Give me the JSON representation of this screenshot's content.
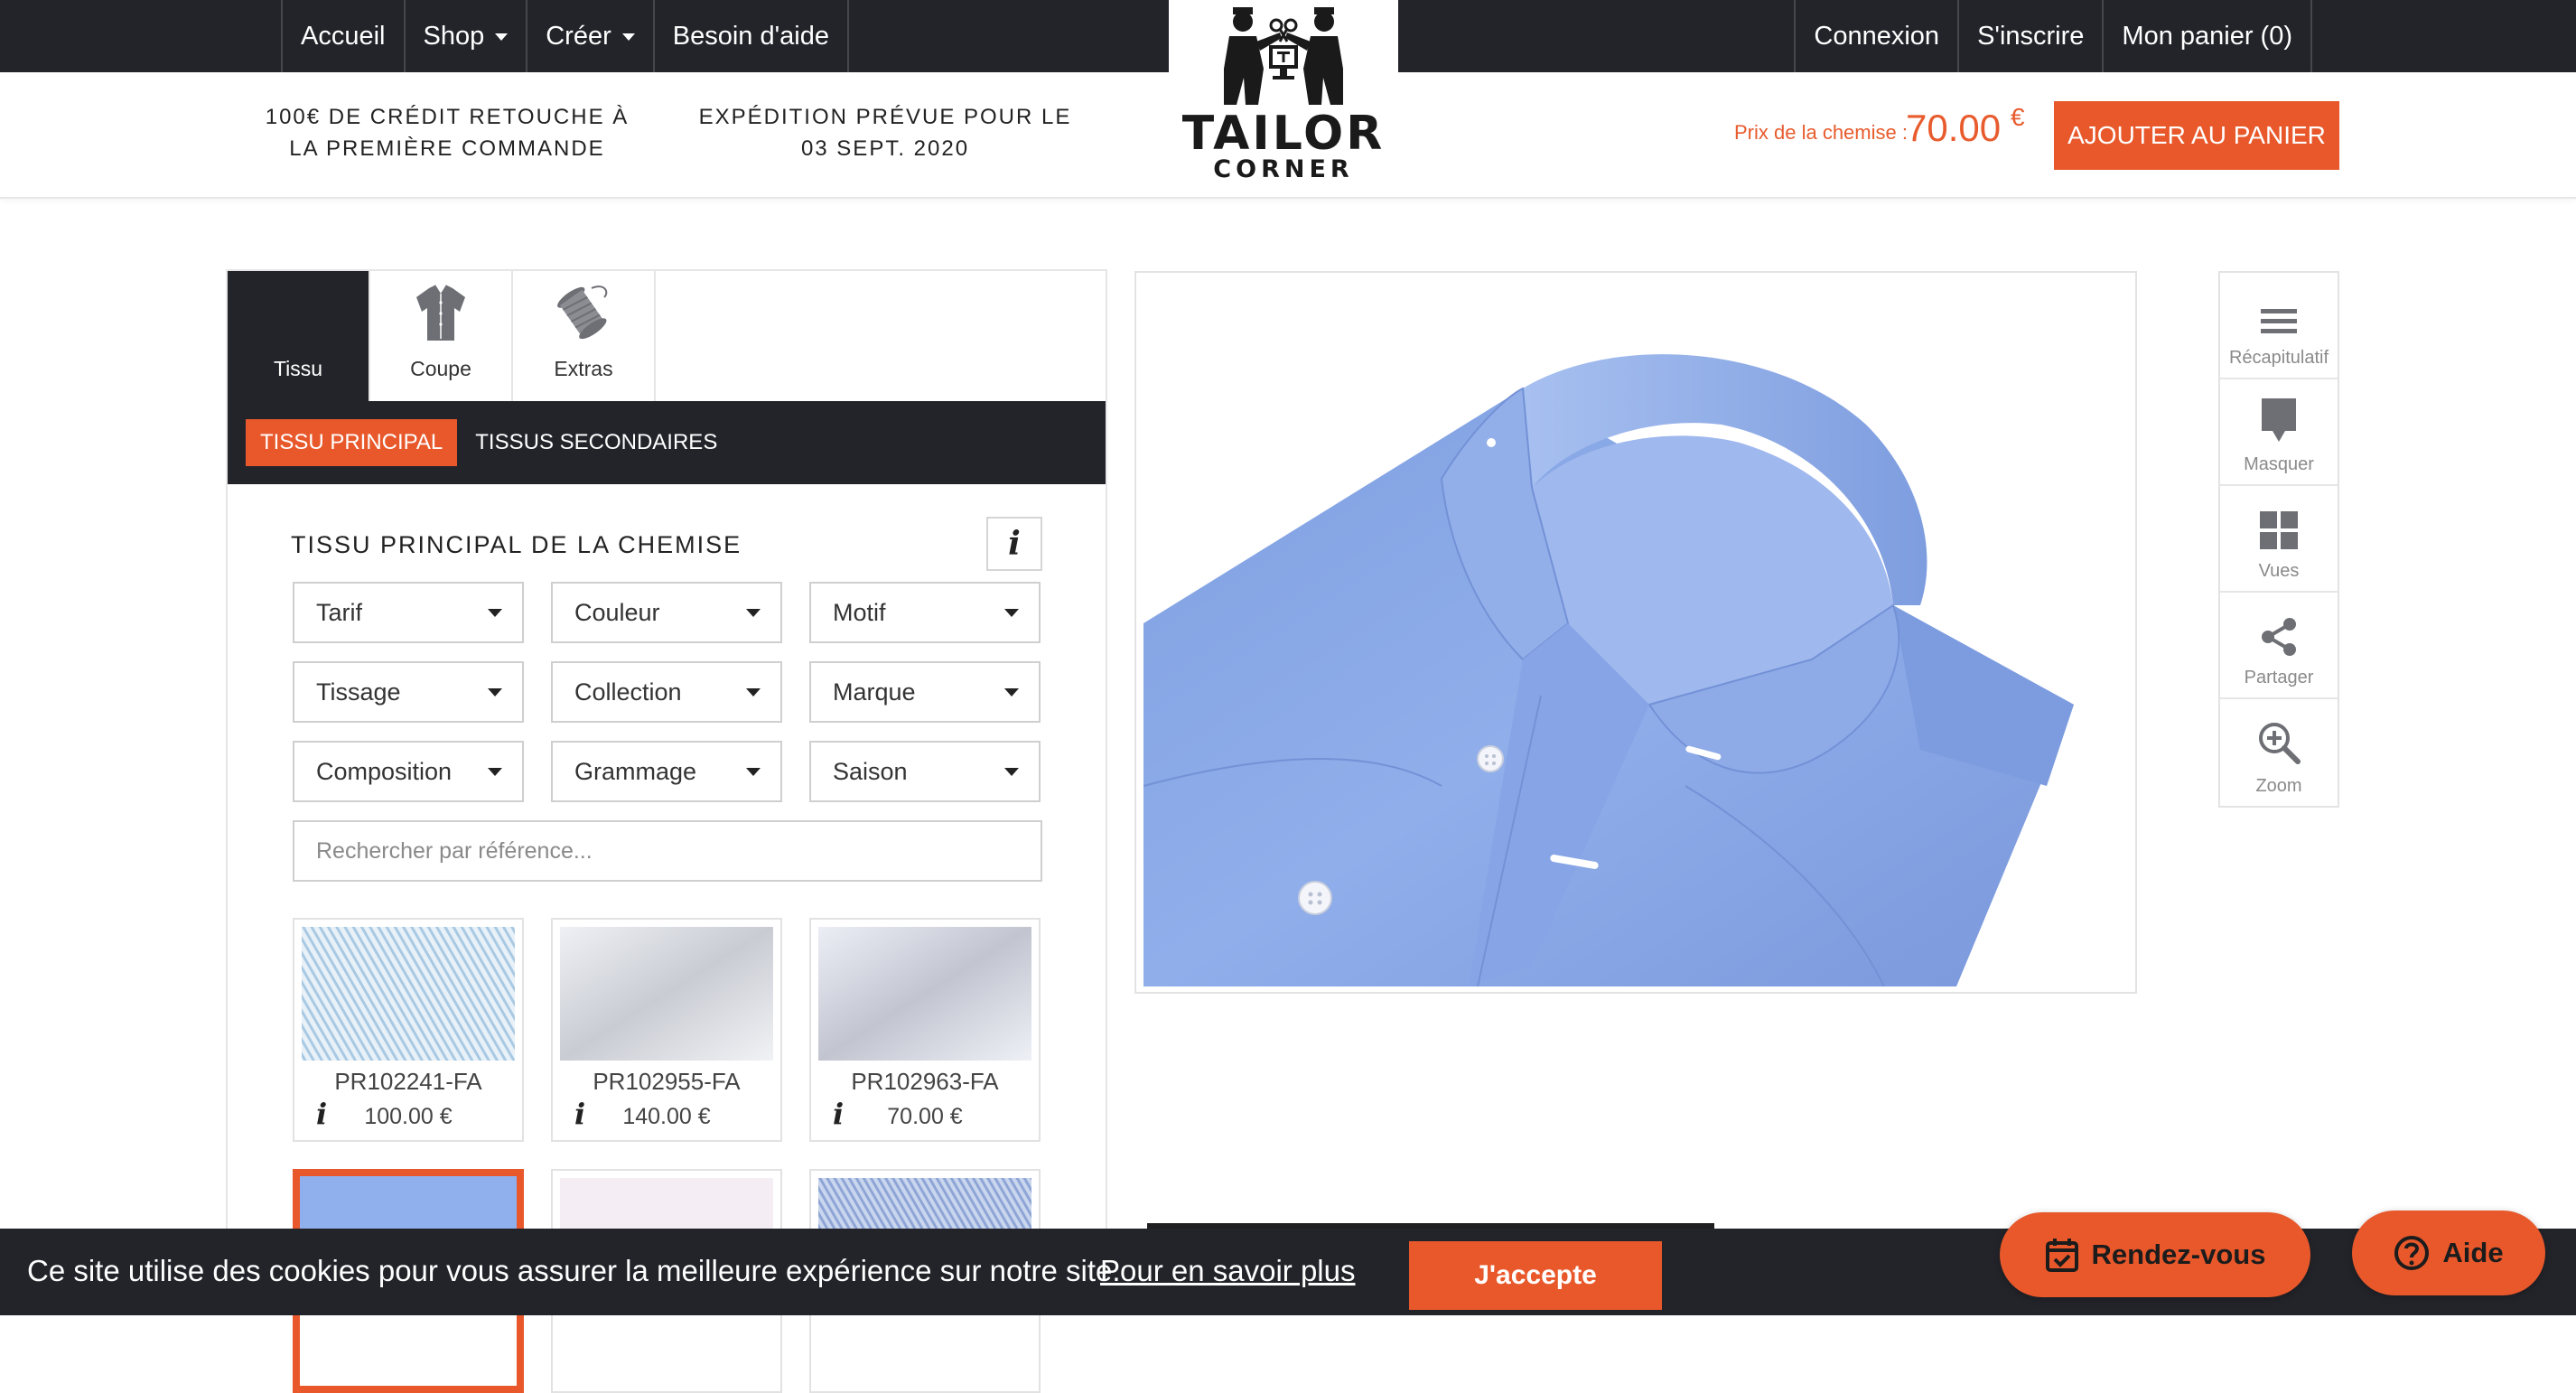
{
  "nav": {
    "left": [
      {
        "label": "Accueil",
        "dropdown": false
      },
      {
        "label": "Shop",
        "dropdown": true
      },
      {
        "label": "Créer",
        "dropdown": true
      },
      {
        "label": "Besoin d'aide",
        "dropdown": false
      }
    ],
    "right": [
      {
        "label": "Connexion"
      },
      {
        "label": "S'inscrire"
      },
      {
        "label": "Mon panier (0)"
      }
    ]
  },
  "logo": {
    "line1": "TAILOR",
    "line2": "CORNER"
  },
  "promo": {
    "credit": "100€ de crédit retouche à la première commande",
    "shipping": "Expédition prévue pour le 03 sept. 2020"
  },
  "price": {
    "label": "Prix de la chemise :",
    "value": "70.00",
    "currency": "€"
  },
  "add_to_cart": "Ajouter au panier",
  "tabs": [
    {
      "label": "Tissu",
      "icon": "fabric-icon",
      "active": true
    },
    {
      "label": "Coupe",
      "icon": "shirt-icon",
      "active": false
    },
    {
      "label": "Extras",
      "icon": "thread-spool-icon",
      "active": false
    }
  ],
  "subtabs": [
    {
      "label": "Tissu principal",
      "active": true
    },
    {
      "label": "Tissus secondaires",
      "active": false
    }
  ],
  "section_title": "Tissu principal de la chemise",
  "info_glyph": "i",
  "filters": [
    "Tarif",
    "Couleur",
    "Motif",
    "Tissage",
    "Collection",
    "Marque",
    "Composition",
    "Grammage",
    "Saison"
  ],
  "search_placeholder": "Rechercher par référence...",
  "fabrics": [
    {
      "ref": "PR102241-FA",
      "price": "100.00 €"
    },
    {
      "ref": "PR102955-FA",
      "price": "140.00 €"
    },
    {
      "ref": "PR102963-FA",
      "price": "70.00 €"
    }
  ],
  "side_tools": [
    {
      "label": "Récapitulatif",
      "icon": "menu-icon"
    },
    {
      "label": "Masquer",
      "icon": "comment-icon"
    },
    {
      "label": "Vues",
      "icon": "grid-icon"
    },
    {
      "label": "Partager",
      "icon": "share-icon"
    },
    {
      "label": "Zoom",
      "icon": "zoom-icon"
    }
  ],
  "cookie": {
    "text": "Ce site utilise des cookies pour vous assurer la meilleure expérience sur notre site.",
    "link": "Pour en savoir plus",
    "accept": "J'accepte"
  },
  "floating": {
    "appointment": "Rendez-vous",
    "help": "Aide"
  },
  "colors": {
    "accent": "#e8582b",
    "dark": "#23242a",
    "shirt": "#86a7e6"
  }
}
